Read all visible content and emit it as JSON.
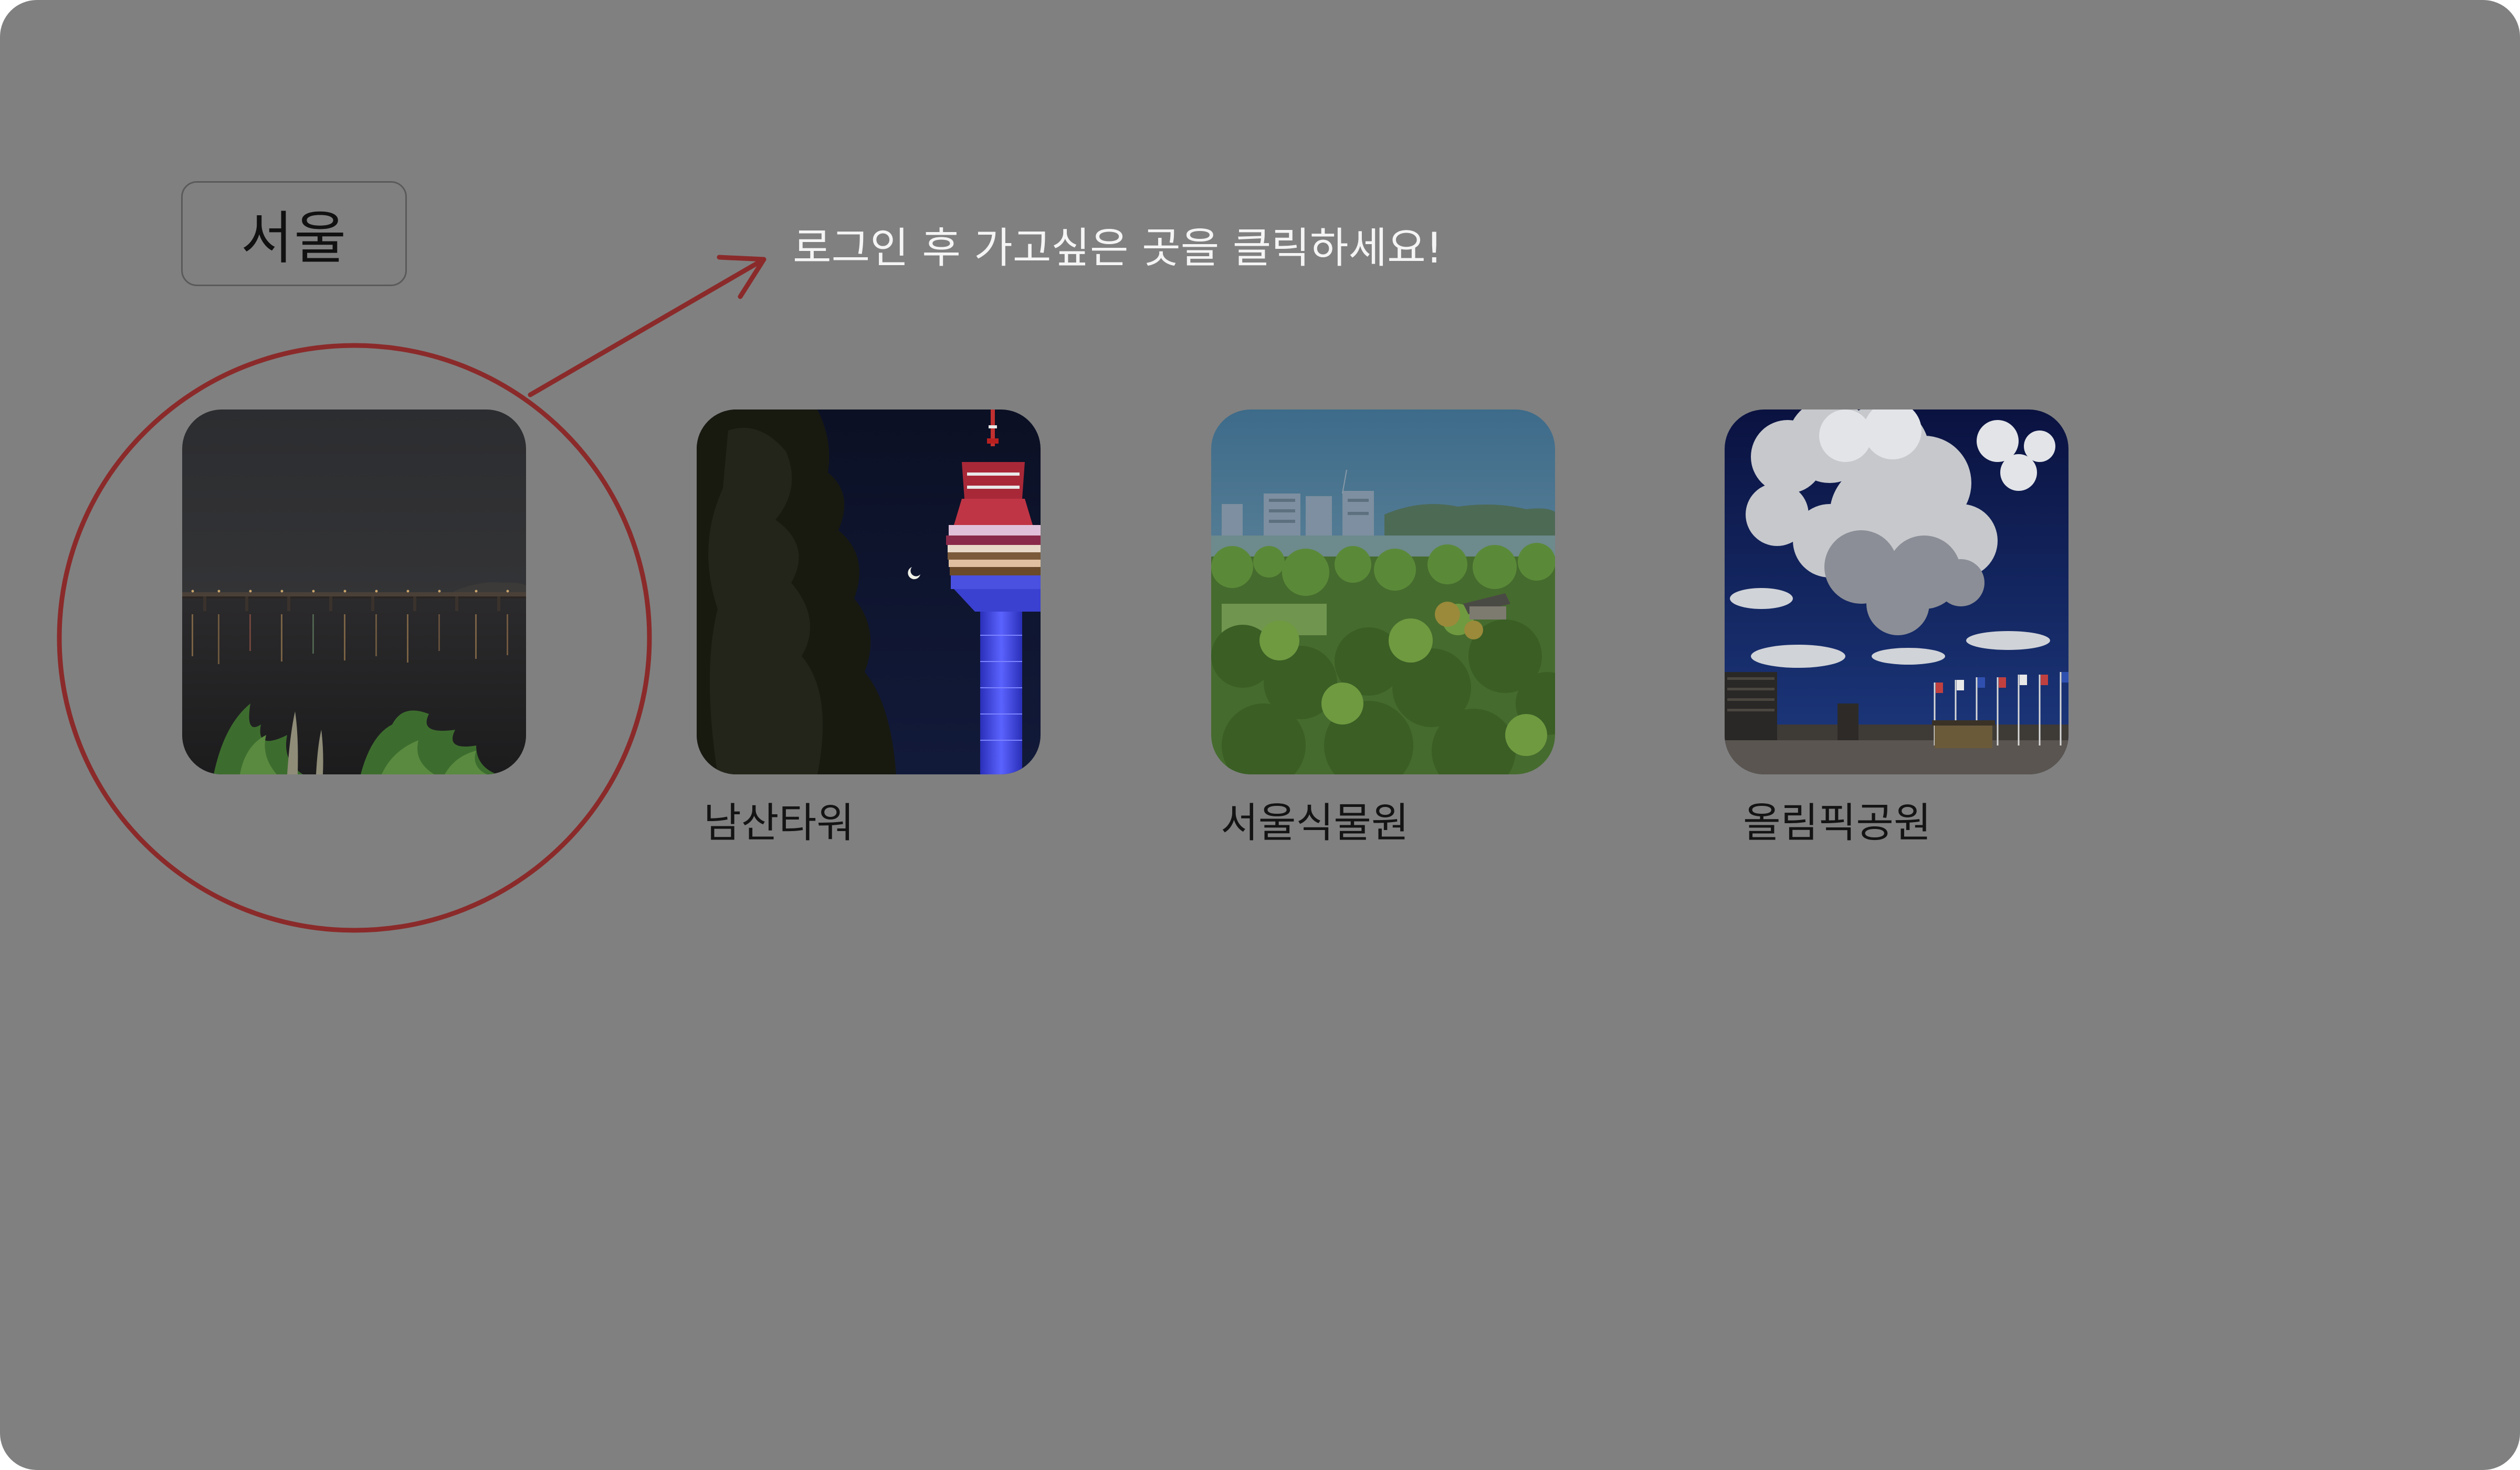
{
  "header": {
    "city_label": "서울",
    "hint": "로그인 후 가고싶은 곳을 클릭하세요!"
  },
  "annotation": {
    "color": "#8b2a2a"
  },
  "places": [
    {
      "label": "",
      "icon": "han-river-night-photo"
    },
    {
      "label": "남산타워",
      "icon": "namsan-tower-photo"
    },
    {
      "label": "서울식물원",
      "icon": "seoul-botanic-park-photo"
    },
    {
      "label": "올림픽공원",
      "icon": "olympic-park-photo"
    }
  ]
}
